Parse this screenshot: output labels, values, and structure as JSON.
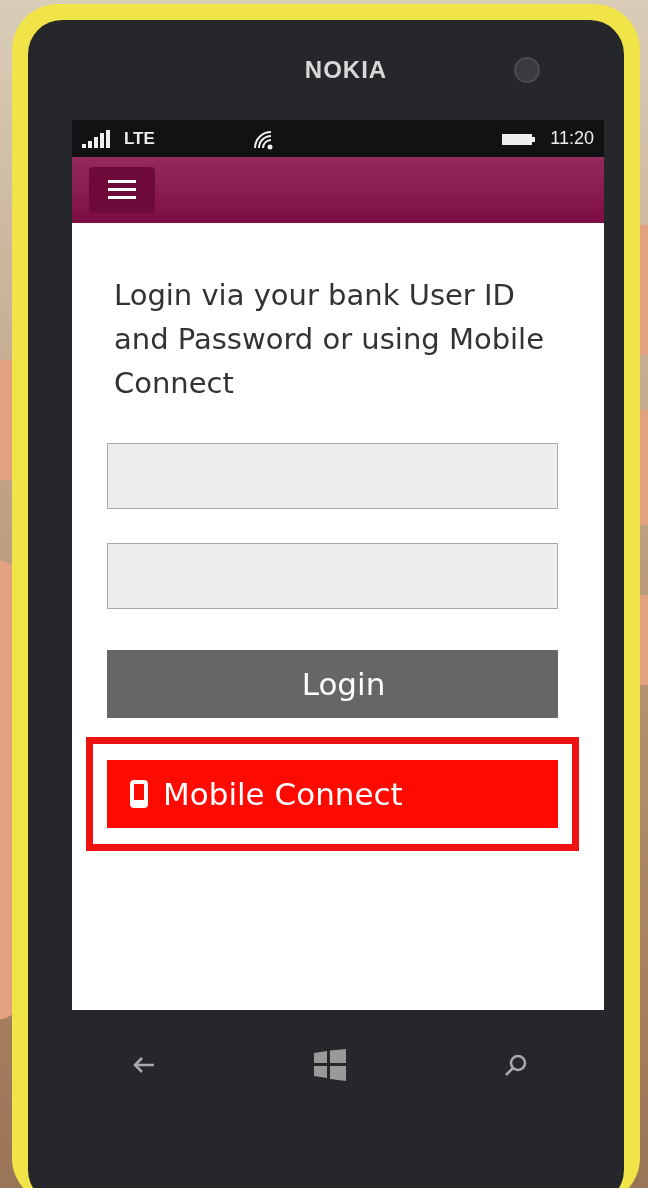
{
  "device": {
    "brand": "NOKIA"
  },
  "status_bar": {
    "network": "LTE",
    "time": "11:20"
  },
  "login": {
    "prompt": "Login via your bank User ID and Password or using Mobile Connect"
  },
  "buttons": [
    {
      "kind": "login",
      "label": "Login",
      "highlighted": false
    },
    {
      "kind": "mobile_connect",
      "label": "Mobile Connect",
      "highlighted": true
    }
  ]
}
